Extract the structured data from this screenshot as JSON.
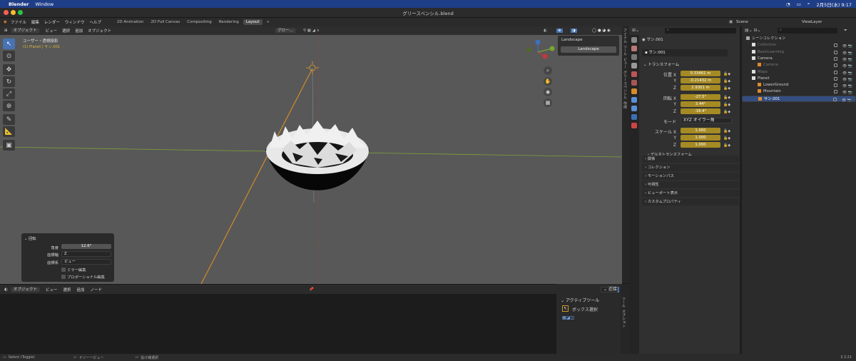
{
  "macbar": {
    "app": "Blender",
    "menu": "Window",
    "date": "2月5日(水) 9:17"
  },
  "window": {
    "title": "グリースペンシル.blend"
  },
  "menubar": {
    "items": [
      "ファイル",
      "編集",
      "レンダー",
      "ウィンドウ",
      "ヘルプ"
    ],
    "tabs": [
      "2D Animation",
      "2D Full Canvas",
      "Compositing",
      "Rendering",
      "Layout"
    ],
    "active_tab": "Layout"
  },
  "viewport_header": {
    "mode": "オブジェクト",
    "menus": [
      "ビュー",
      "選択",
      "追加",
      "オブジェクト"
    ],
    "orientation": "グロー..."
  },
  "viewport": {
    "view_name": "ユーザー・透視投影",
    "object_info": "(1) Planet | サン.001"
  },
  "npanel": {
    "title": "Landscape",
    "button": "Landscape"
  },
  "sidetabs": [
    "アイテム",
    "ツール",
    "ビュー",
    "グリースペンシル",
    "作成"
  ],
  "ops_panel": {
    "title": "回転",
    "angle_label": "角度",
    "angle_value": "12.6°",
    "axis_label": "座標軸",
    "axis_value": "Z",
    "orient_label": "座標系",
    "orient_value": "ビュー",
    "mirror": "ミラー編集",
    "proportional": "プロポーショナル編集"
  },
  "node_header": {
    "mode": "オブジェクト",
    "menus": [
      "ビュー",
      "選択",
      "追加",
      "ノード"
    ]
  },
  "node_side": {
    "title": "アクティブツール",
    "tool": "ボックス選択",
    "tabs": [
      "ツール",
      "オプション"
    ]
  },
  "props": {
    "object_name": "サン.001",
    "transform_title": "トランスフォーム",
    "location_label": "位置 X",
    "location": [
      "0.33461 m",
      "-0.21432 m",
      "2.9301 m"
    ],
    "rotation_label": "回転 X",
    "rotation": [
      "-27.5°",
      "3.44°",
      "-16.4°"
    ],
    "mode_label": "モード",
    "mode_value": "XYZ オイラー角",
    "scale_label": "スケール X",
    "scale": [
      "1.000",
      "1.000",
      "1.000"
    ],
    "axis_y": "Y",
    "axis_z": "Z",
    "delta": "デルタトランスフォーム",
    "sections": [
      "関係",
      "コレクション",
      "モーションパス",
      "可視性",
      "ビューポート表示",
      "カスタムプロパティ"
    ]
  },
  "outliner": {
    "scene": "Scene",
    "view_layer": "ViewLayer",
    "rows": [
      {
        "label": "シーンコレクション",
        "indent": 0,
        "color": "#cfcfcf"
      },
      {
        "label": "Collection",
        "indent": 1,
        "color": "#777777"
      },
      {
        "label": "BasicLearning",
        "indent": 1,
        "color": "#777777"
      },
      {
        "label": "Camera",
        "indent": 1,
        "color": "#cfcfcf"
      },
      {
        "label": "Camera",
        "indent": 2,
        "color": "#777777"
      },
      {
        "label": "Maps",
        "indent": 1,
        "color": "#777777"
      },
      {
        "label": "Planet",
        "indent": 1,
        "color": "#cfcfcf"
      },
      {
        "label": "LowerGround",
        "indent": 2,
        "color": "#cfcfcf"
      },
      {
        "label": "Mountain",
        "indent": 2,
        "color": "#cfcfcf"
      },
      {
        "label": "サン.001",
        "indent": 2,
        "color": "#ffffff",
        "selected": true
      }
    ]
  },
  "status": {
    "select": "Select (Toggle)",
    "tree": "ドリーービュー",
    "lasso": "投げ縄選択",
    "version": "3.3.21"
  }
}
